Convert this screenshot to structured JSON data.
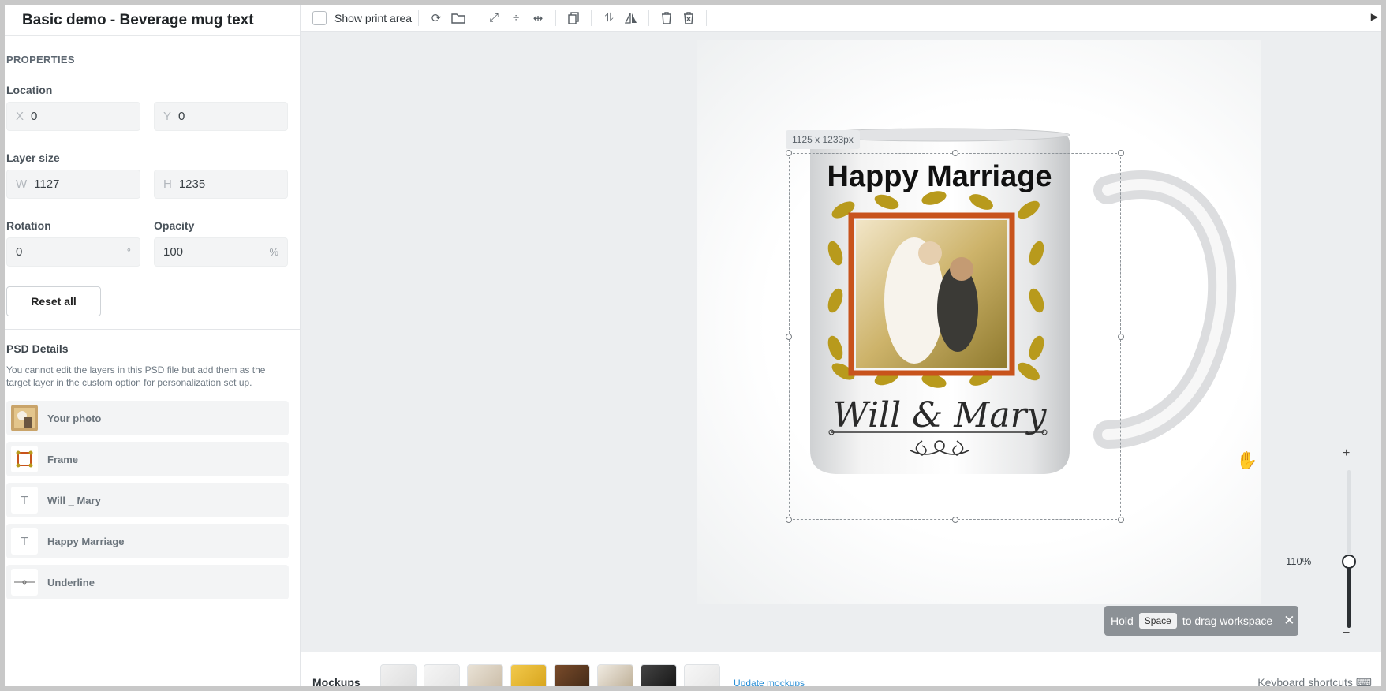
{
  "app": {
    "title": "Basic demo - Beverage mug text"
  },
  "properties": {
    "heading": "PROPERTIES",
    "location": {
      "label": "Location",
      "x_prefix": "X",
      "x_value": "0",
      "y_prefix": "Y",
      "y_value": "0"
    },
    "layer_size": {
      "label": "Layer size",
      "w_prefix": "W",
      "w_value": "1127",
      "h_prefix": "H",
      "h_value": "1235"
    },
    "rotation": {
      "label": "Rotation",
      "value": "0",
      "suffix": "°"
    },
    "opacity": {
      "label": "Opacity",
      "value": "100",
      "suffix": "%"
    },
    "reset_label": "Reset all"
  },
  "psd": {
    "title": "PSD Details",
    "description": "You cannot edit the layers in this PSD file but add them as the target layer in the custom option for personalization set up.",
    "layers": [
      {
        "name": "Your photo",
        "icon": "photo-icon"
      },
      {
        "name": "Frame",
        "icon": "frame-icon"
      },
      {
        "name": "Will _ Mary",
        "icon": "text-icon"
      },
      {
        "name": "Happy Marriage",
        "icon": "text-icon"
      },
      {
        "name": "Underline",
        "icon": "line-icon"
      }
    ]
  },
  "toolbar": {
    "show_print_area": "Show print area"
  },
  "canvas": {
    "size_badge": "1125 x 1233px",
    "mug_title": "Happy Marriage",
    "mug_names": "Will & Mary"
  },
  "hint": {
    "before": "Hold",
    "key": "Space",
    "after": "to drag workspace"
  },
  "zoom": {
    "plus": "+",
    "level": "110%",
    "minus": "−",
    "fraction": 0.42
  },
  "bottom": {
    "mockups_label": "Mockups",
    "update_label": "Update mockups",
    "keyboard_shortcuts": "Keyboard shortcuts"
  },
  "colors": {
    "accent_link": "#2a8fd6",
    "frame_orange": "#c8531c",
    "leaf_gold": "#b89a1c"
  }
}
